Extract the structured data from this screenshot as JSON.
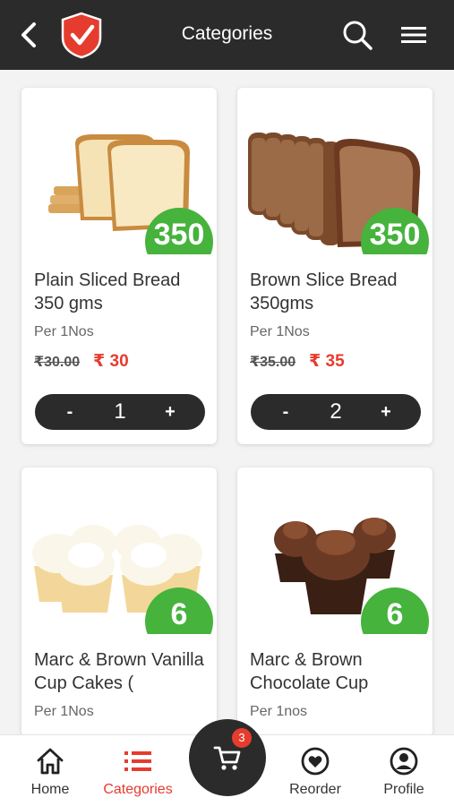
{
  "header": {
    "title": "Categories",
    "back_icon": "chevron-left-icon",
    "logo_icon": "shield-check-logo",
    "search_icon": "search-icon",
    "menu_icon": "hamburger-menu-icon"
  },
  "products": [
    {
      "name": "Plain Sliced Bread 350 gms",
      "badge": "350",
      "per": "Per 1Nos",
      "mrp": "₹30.00",
      "price": "₹ 30",
      "qty": "1",
      "minus": "-",
      "plus": "+"
    },
    {
      "name": "Brown Slice Bread 350gms",
      "badge": "350",
      "per": "Per 1Nos",
      "mrp": "₹35.00",
      "price": "₹ 35",
      "qty": "2",
      "minus": "-",
      "plus": "+"
    },
    {
      "name": "Marc & Brown Vanilla Cup Cakes (",
      "badge": "6",
      "per": "Per 1Nos"
    },
    {
      "name": "Marc & Brown Chocolate Cup",
      "badge": "6",
      "per": "Per 1nos"
    }
  ],
  "nav": {
    "home": "Home",
    "categories": "Categories",
    "cart_count": "3",
    "reorder": "Reorder",
    "profile": "Profile"
  },
  "colors": {
    "header_bg": "#2b2b2b",
    "accent_red": "#e53c2e",
    "badge_green": "#45b33c"
  }
}
